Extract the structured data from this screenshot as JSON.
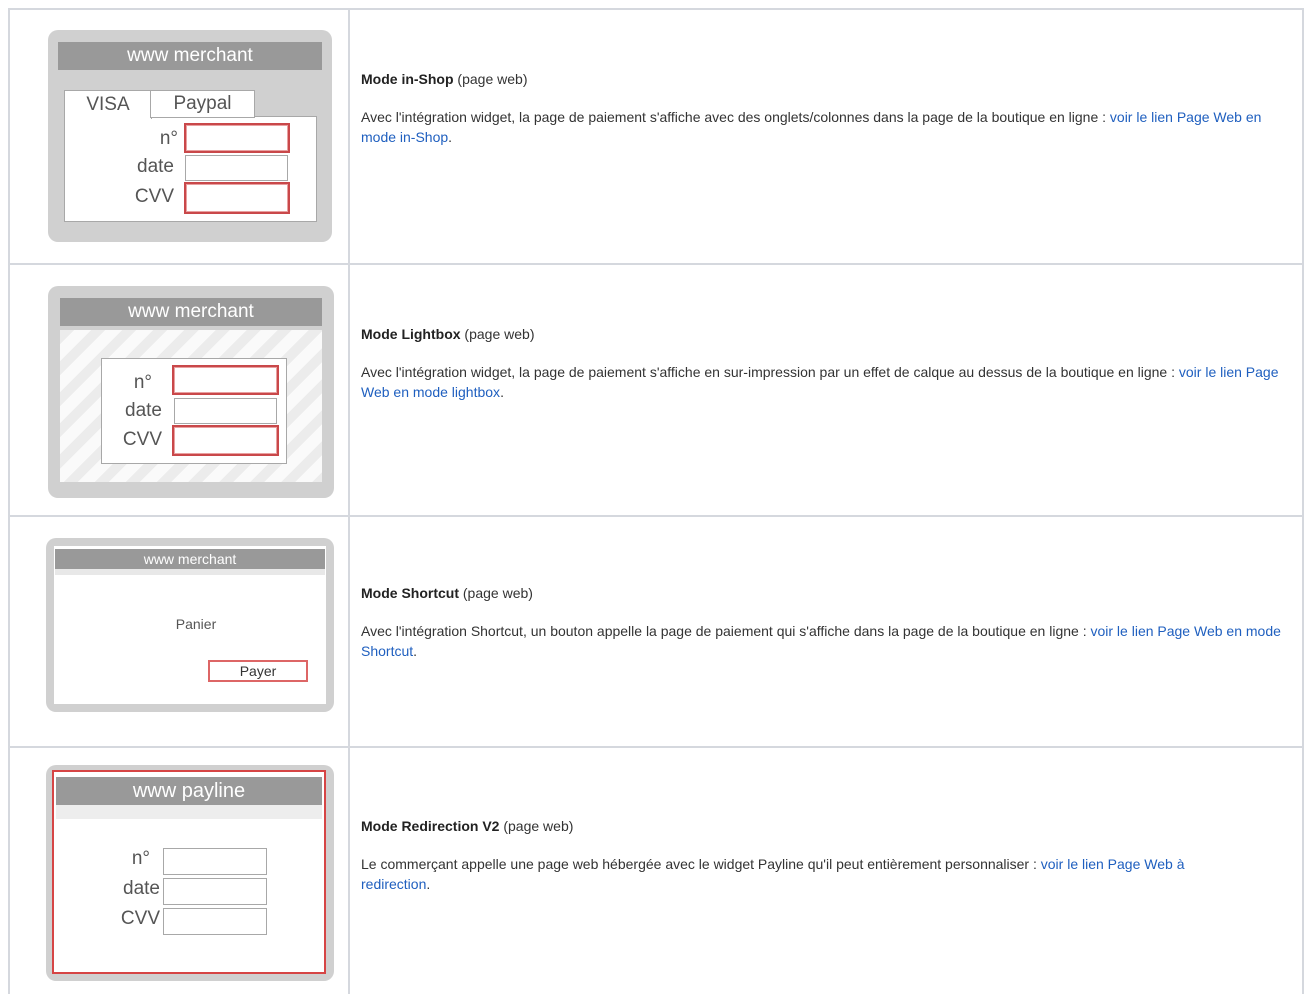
{
  "rows": [
    {
      "mode_title": "Mode in-Shop",
      "mode_suffix": " (page web)",
      "desc_before": "Avec l'intégration widget, la page de paiement s'affiche avec des onglets/colonnes dans la page de la boutique en ligne : ",
      "link": "voir le lien Page Web en mode in-Shop",
      "desc_after": ".",
      "illustration": {
        "bar_title": "www merchant",
        "tabs": [
          "VISA",
          "Paypal"
        ],
        "fields": [
          "n°",
          "date",
          "CVV"
        ]
      }
    },
    {
      "mode_title": "Mode Lightbox",
      "mode_suffix": " (page web)",
      "desc_before": "Avec l'intégration widget, la page de paiement s'affiche en sur-impression par un effet de calque au dessus de la boutique en ligne : ",
      "link": "voir le lien Page Web en mode lightbox",
      "desc_after": ".",
      "illustration": {
        "bar_title": "www merchant",
        "fields": [
          "n°",
          "date",
          "CVV"
        ]
      }
    },
    {
      "mode_title": "Mode Shortcut",
      "mode_suffix": " (page web)",
      "desc_before": "Avec l'intégration Shortcut, un bouton appelle la page de paiement qui s'affiche dans la page de la boutique en ligne : ",
      "link": "voir le lien Page Web en mode Shortcut",
      "desc_after": ".",
      "illustration": {
        "bar_title": "www merchant",
        "cart_label": "Panier",
        "pay_button": "Payer"
      }
    },
    {
      "mode_title": "Mode Redirection V2",
      "mode_suffix": " (page web)",
      "desc_before": "Le commerçant appelle une page web hébergée avec le widget Payline qu'il peut entièrement personnaliser  : ",
      "link": "voir le lien Page Web à redirection",
      "desc_after": ".",
      "illustration": {
        "bar_title": "www payline",
        "fields": [
          "n°",
          "date",
          "CVV"
        ]
      }
    }
  ],
  "colors": {
    "link": "#1f5fbf",
    "grid": "#d5d8de",
    "frame": "#d0d0d0",
    "title_bar": "#999999",
    "highlight_border": "#c9484a"
  }
}
